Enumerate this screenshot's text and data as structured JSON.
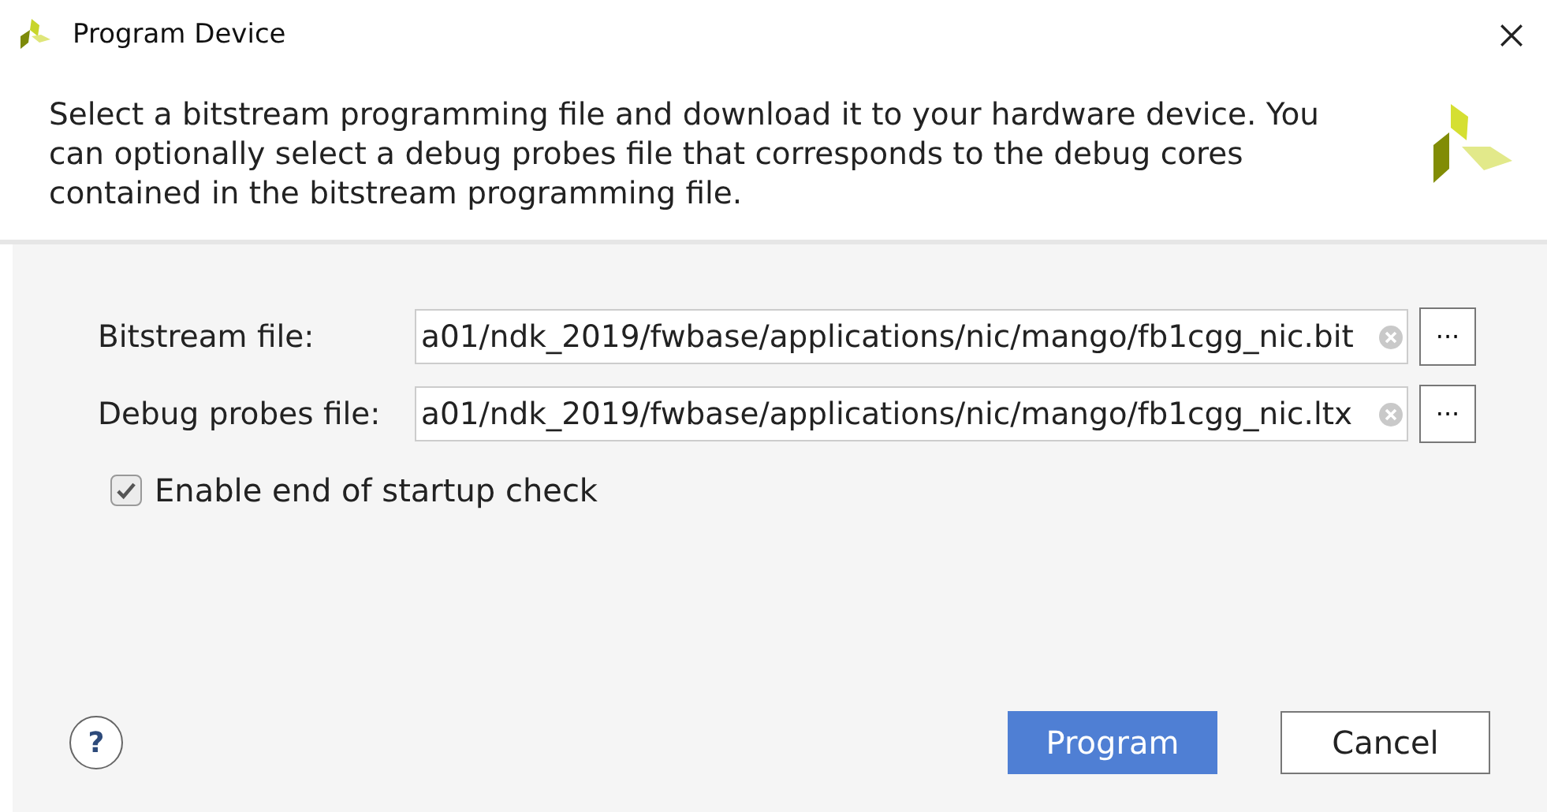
{
  "window": {
    "title": "Program Device"
  },
  "description": "Select a bitstream programming file and download it to your hardware device. You can optionally select a debug probes file that corresponds to the debug cores contained in the bitstream programming file.",
  "fields": [
    {
      "label": "Bitstream file:",
      "value": "a01/ndk_2019/fwbase/applications/nic/mango/fb1cgg_nic.bit",
      "browse": "···"
    },
    {
      "label": "Debug probes file:",
      "value": "a01/ndk_2019/fwbase/applications/nic/mango/fb1cgg_nic.ltx",
      "browse": "···"
    }
  ],
  "checkbox": {
    "label": "Enable end of startup check",
    "checked": true
  },
  "help": "?",
  "buttons": [
    {
      "label": "Program",
      "kind": "primary"
    },
    {
      "label": "Cancel",
      "kind": "default"
    }
  ]
}
